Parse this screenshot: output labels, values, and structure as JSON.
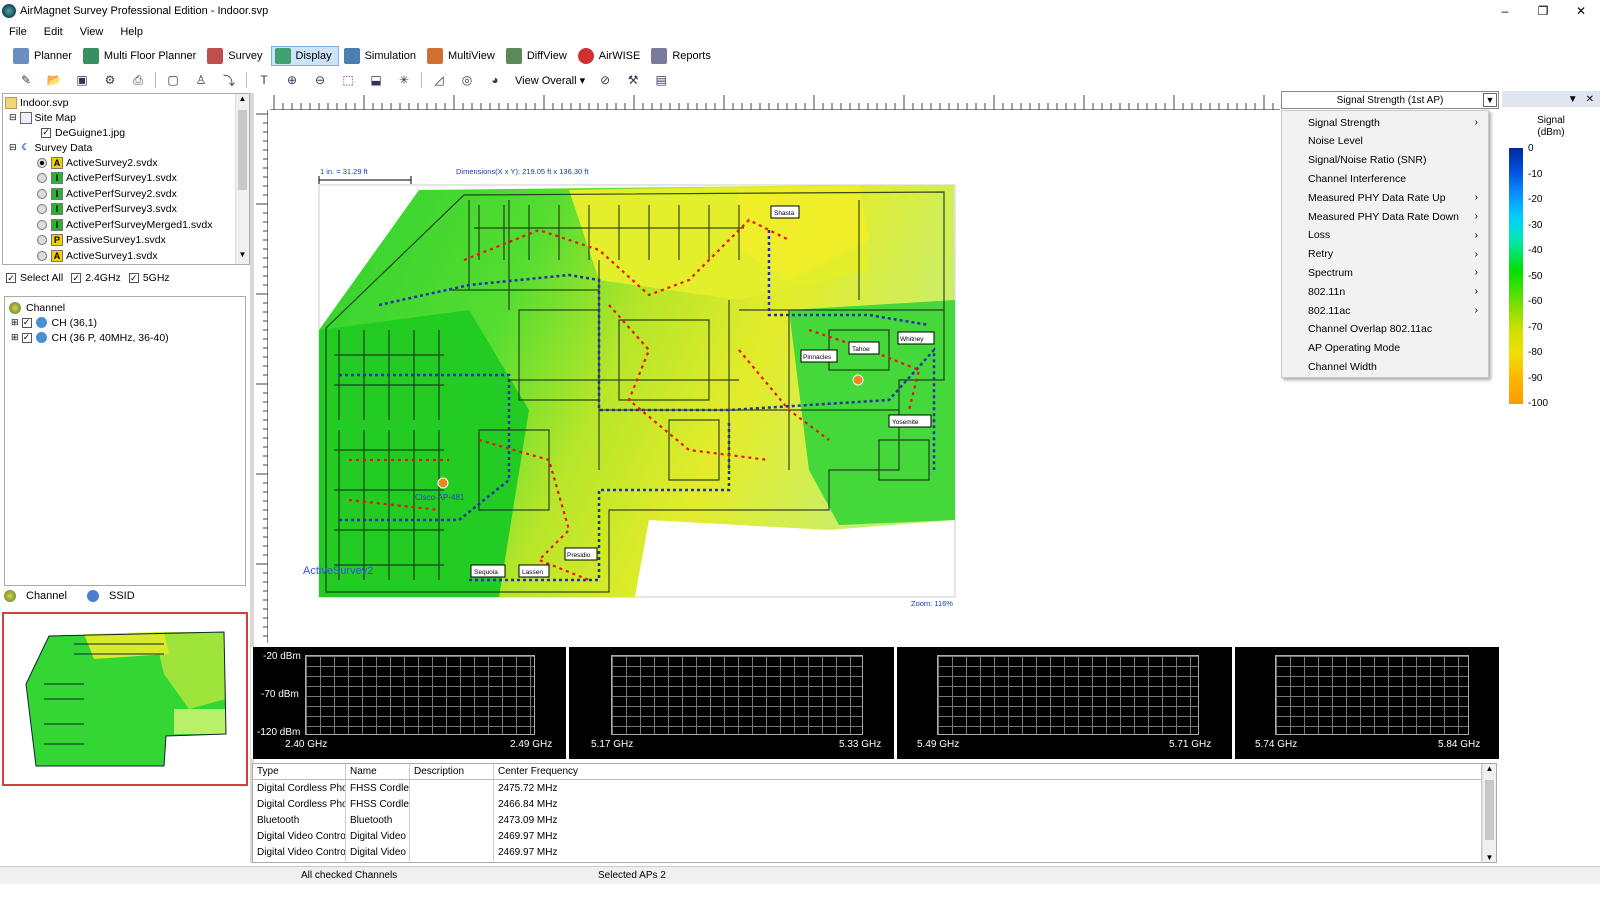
{
  "window": {
    "title": "AirMagnet Survey Professional Edition - Indoor.svp",
    "minimize": "–",
    "restore": "❐",
    "close": "✕"
  },
  "menubar": [
    "File",
    "Edit",
    "View",
    "Help"
  ],
  "toolbar_tabs": [
    {
      "label": "Planner",
      "color": "#6b8fbf"
    },
    {
      "label": "Multi Floor Planner",
      "color": "#3a8f5f"
    },
    {
      "label": "Survey",
      "color": "#c05050"
    },
    {
      "label": "Display",
      "color": "#3fa070"
    },
    {
      "label": "Simulation",
      "color": "#4a7fb0"
    },
    {
      "label": "MultiView",
      "color": "#d07030"
    },
    {
      "label": "DiffView",
      "color": "#5a8a5a"
    },
    {
      "label": "AirWISE",
      "color": "#d03030"
    },
    {
      "label": "Reports",
      "color": "#7a7a9a"
    }
  ],
  "toolbar2": {
    "view_overall": "View Overall ▾"
  },
  "project_tree": {
    "root": "Indoor.svp",
    "site_map": "Site Map",
    "site_map_file": "DeGuigne1.jpg",
    "survey_data": "Survey Data",
    "surveys": [
      {
        "name": "ActiveSurvey2.svdx",
        "badge": "A",
        "badge_color": "#f0d000",
        "selected": true
      },
      {
        "name": "ActivePerfSurvey1.svdx",
        "badge": "I",
        "badge_color": "#30b030",
        "selected": false
      },
      {
        "name": "ActivePerfSurvey2.svdx",
        "badge": "I",
        "badge_color": "#30b030",
        "selected": false
      },
      {
        "name": "ActivePerfSurvey3.svdx",
        "badge": "I",
        "badge_color": "#30b030",
        "selected": false
      },
      {
        "name": "ActivePerfSurveyMerged1.svdx",
        "badge": "I",
        "badge_color": "#30b030",
        "selected": false
      },
      {
        "name": "PassiveSurvey1.svdx",
        "badge": "P",
        "badge_color": "#f0d000",
        "selected": false
      },
      {
        "name": "ActiveSurvey1.svdx",
        "badge": "A",
        "badge_color": "#f0d000",
        "selected": false
      }
    ]
  },
  "filters": {
    "select_all": "Select All",
    "ghz24": "2.4GHz",
    "ghz5": "5GHz"
  },
  "channel_tree": {
    "root": "Channel",
    "items": [
      "CH (36,1)",
      "CH (36 P, 40MHz, 36-40)"
    ]
  },
  "left_tabs": {
    "channel": "Channel",
    "ssid": "SSID"
  },
  "map": {
    "scale": "1 in. = 31.29 ft",
    "dimensions": "Dimensions(X x Y): 219.05 ft x 136.30 ft",
    "survey_label": "ActiveSurvey2",
    "zoom": "Zoom: 116%",
    "ap_label": "Cisco-AP-481",
    "rooms": [
      "Shasta",
      "Whitney",
      "Tahoe",
      "Pinnacles",
      "Yosemite",
      "Sequoia",
      "Lassen",
      "Presidio"
    ]
  },
  "display_dropdown": {
    "value": "Signal Strength (1st AP)"
  },
  "display_menu": [
    {
      "label": "Signal Strength",
      "sub": true
    },
    {
      "label": "Noise Level",
      "sub": false
    },
    {
      "label": "Signal/Noise Ratio (SNR)",
      "sub": false
    },
    {
      "label": "Channel Interference",
      "sub": false
    },
    {
      "label": "Measured PHY Data Rate Up",
      "sub": true
    },
    {
      "label": "Measured PHY Data Rate Down",
      "sub": true
    },
    {
      "label": "Loss",
      "sub": true
    },
    {
      "label": "Retry",
      "sub": true
    },
    {
      "label": "Spectrum",
      "sub": true
    },
    {
      "label": "802.11n",
      "sub": true
    },
    {
      "label": "802.11ac",
      "sub": true
    },
    {
      "label": "Channel Overlap 802.11ac",
      "sub": false
    },
    {
      "label": "AP Operating Mode",
      "sub": false
    },
    {
      "label": "Channel Width",
      "sub": false
    }
  ],
  "legend": {
    "title_line1": "Signal",
    "title_line2": "(dBm)",
    "ticks": [
      "0",
      "-10",
      "-20",
      "-30",
      "-40",
      "-50",
      "-60",
      "-70",
      "-80",
      "-90",
      "-100"
    ]
  },
  "spectrum": {
    "y_labels": [
      "-20 dBm",
      "-70 dBm",
      "-120 dBm"
    ],
    "panels": [
      {
        "from": "2.40 GHz",
        "to": "2.49 GHz"
      },
      {
        "from": "5.17 GHz",
        "to": "5.33 GHz"
      },
      {
        "from": "5.49 GHz",
        "to": "5.71 GHz"
      },
      {
        "from": "5.74 GHz",
        "to": "5.84 GHz"
      }
    ]
  },
  "devices_table": {
    "headers": [
      "Type",
      "Name",
      "Description",
      "Center Frequency"
    ],
    "rows": [
      [
        "Digital Cordless Phon...",
        "FHSS Cordles...",
        "",
        "2475.72 MHz"
      ],
      [
        "Digital Cordless Phon...",
        "FHSS Cordles...",
        "",
        "2466.84 MHz"
      ],
      [
        "Bluetooth",
        "Bluetooth",
        "",
        "2473.09 MHz"
      ],
      [
        "Digital Video Controller",
        "Digital Video ...",
        "",
        "2469.97 MHz"
      ],
      [
        "Digital Video Controller",
        "Digital Video ...",
        "",
        "2469.97 MHz"
      ]
    ]
  },
  "status": {
    "channels": "All checked Channels",
    "aps": "Selected APs 2"
  }
}
